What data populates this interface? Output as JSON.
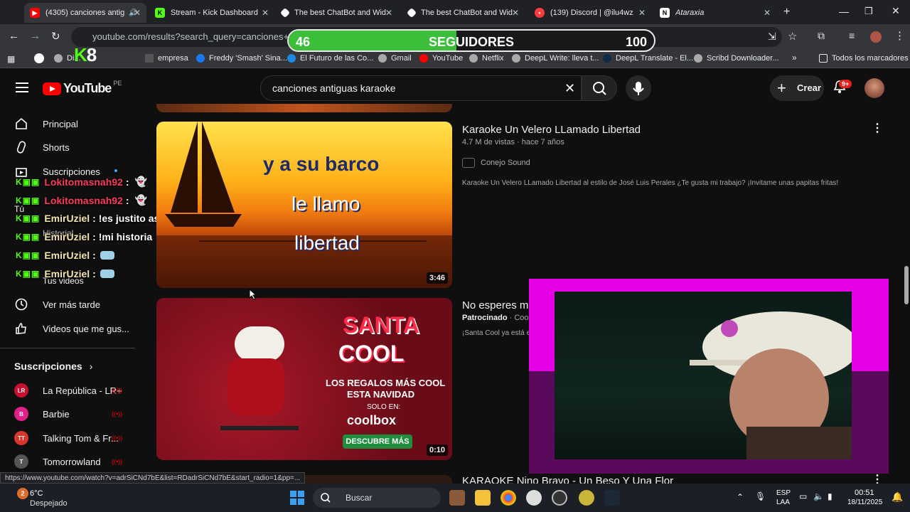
{
  "browser": {
    "tabs": [
      {
        "label": "(4305) canciones antig",
        "icon": "youtube-icon",
        "active": true
      },
      {
        "label": "Stream - Kick Dashboard",
        "icon": "kick-icon"
      },
      {
        "label": "The best ChatBot and Wid",
        "icon": "chatbot-icon"
      },
      {
        "label": "The best ChatBot and Wid",
        "icon": "chatbot-icon"
      },
      {
        "label": "(139) Discord | @ilu4wz",
        "icon": "discord-icon"
      },
      {
        "label": "Ataraxia",
        "icon": "notion-icon"
      }
    ],
    "url": "youtube.com/results?search_query=canciones+antig",
    "bookmarks": [
      "Di...",
      "empresa",
      "Freddy 'Smash' Sina...",
      "El Futuro de las Co...",
      "Gmail",
      "YouTube",
      "Netflix",
      "DeepL Write: lleva t...",
      "DeepL Translate - El...",
      "Scribd Downloader...",
      "Todos los marcadores"
    ]
  },
  "overlay": {
    "counter_label": "SEGUIDORES",
    "current": "46",
    "goal": "100",
    "progress_fraction": 0.46,
    "kick_badge": "8"
  },
  "youtube": {
    "logo_text": "YouTube",
    "country_code": "PE",
    "search_value": "canciones antiguas karaoke",
    "create_label": "Crear",
    "notif_badge": "9+"
  },
  "sidebar": {
    "items": [
      {
        "label": "Principal",
        "icon": "home-icon"
      },
      {
        "label": "Shorts",
        "icon": "shorts-icon"
      },
      {
        "label": "Suscripciones",
        "icon": "subscriptions-icon"
      },
      {
        "label": "Tú",
        "icon": ""
      },
      {
        "label": "Historial",
        "icon": "history-icon"
      },
      {
        "label": "Playlists",
        "icon": "playlist-icon"
      },
      {
        "label": "Tus videos",
        "icon": "your-videos-icon"
      },
      {
        "label": "Ver más tarde",
        "icon": "watch-later-icon"
      },
      {
        "label": "Videos que me gus...",
        "icon": "like-icon"
      }
    ],
    "subs_header": "Suscripciones",
    "subs": [
      {
        "label": "La República - LR+",
        "color": "#c8102e",
        "abbr": "LR"
      },
      {
        "label": "Barbie",
        "color": "#e0218a",
        "abbr": "B"
      },
      {
        "label": "Talking Tom & Fr...",
        "color": "#d9362b",
        "abbr": "TT"
      },
      {
        "label": "Tomorrowland",
        "color": "#555555",
        "abbr": "T"
      }
    ]
  },
  "chat": [
    {
      "user": "Lokitomasnah92",
      "color": "#ff3b5c",
      "msg": ":"
    },
    {
      "user": "Lokitomasnah92",
      "color": "#ff3b5c",
      "msg": ":"
    },
    {
      "user": "EmirUziel",
      "color": "#f5e6a8",
      "msg": ": !es justito así me"
    },
    {
      "user": "EmirUziel",
      "color": "#f5e6a8",
      "msg": ": !mi historia"
    },
    {
      "user": "EmirUziel",
      "color": "#f5e6a8",
      "msg": ":"
    },
    {
      "user": "EmirUziel",
      "color": "#f5e6a8",
      "msg": ":"
    }
  ],
  "results": [
    {
      "title": "Karaoke Un Velero LLamado Libertad",
      "meta": "4.7 M de vistas · hace 7 años",
      "channel": "Conejo Sound",
      "desc": "Karaoke Un Velero LLamado Libertad al estilo de José Luis Perales ¿Te gusta mi trabajo? ¡Invitame unas papitas fritas!",
      "duration": "3:46",
      "thumb_lines": [
        "y a su barco",
        "le llamo",
        "libertad"
      ]
    },
    {
      "title": "No esperes m",
      "sponsor": "Patrocinado",
      "channel": "Coolb",
      "desc": "¡Santa Cool ya está e",
      "duration": "0:10",
      "thumb": {
        "title1": "SANTA",
        "title2": "COOL",
        "line1": "LOS REGALOS MÁS COOL",
        "line2": "ESTA NAVIDAD",
        "line3": "SOLO EN:",
        "brand": "coolbox",
        "cta": "DESCUBRE MÁS"
      }
    },
    {
      "title": "KARAOKE Nino Bravo - Un Beso Y Una Flor"
    }
  ],
  "status_url": "https://www.youtube.com/watch?v=adrSiCNd7bE&list=RDadrSiCNd7bE&start_radio=1&pp=...",
  "taskbar": {
    "weather_temp": "6°C",
    "weather_desc": "Despejado",
    "weather_badge": "2",
    "search_label": "Buscar",
    "lang": "ESP",
    "lang2": "LAA",
    "time": "00:51",
    "date": "18/11/2025"
  }
}
